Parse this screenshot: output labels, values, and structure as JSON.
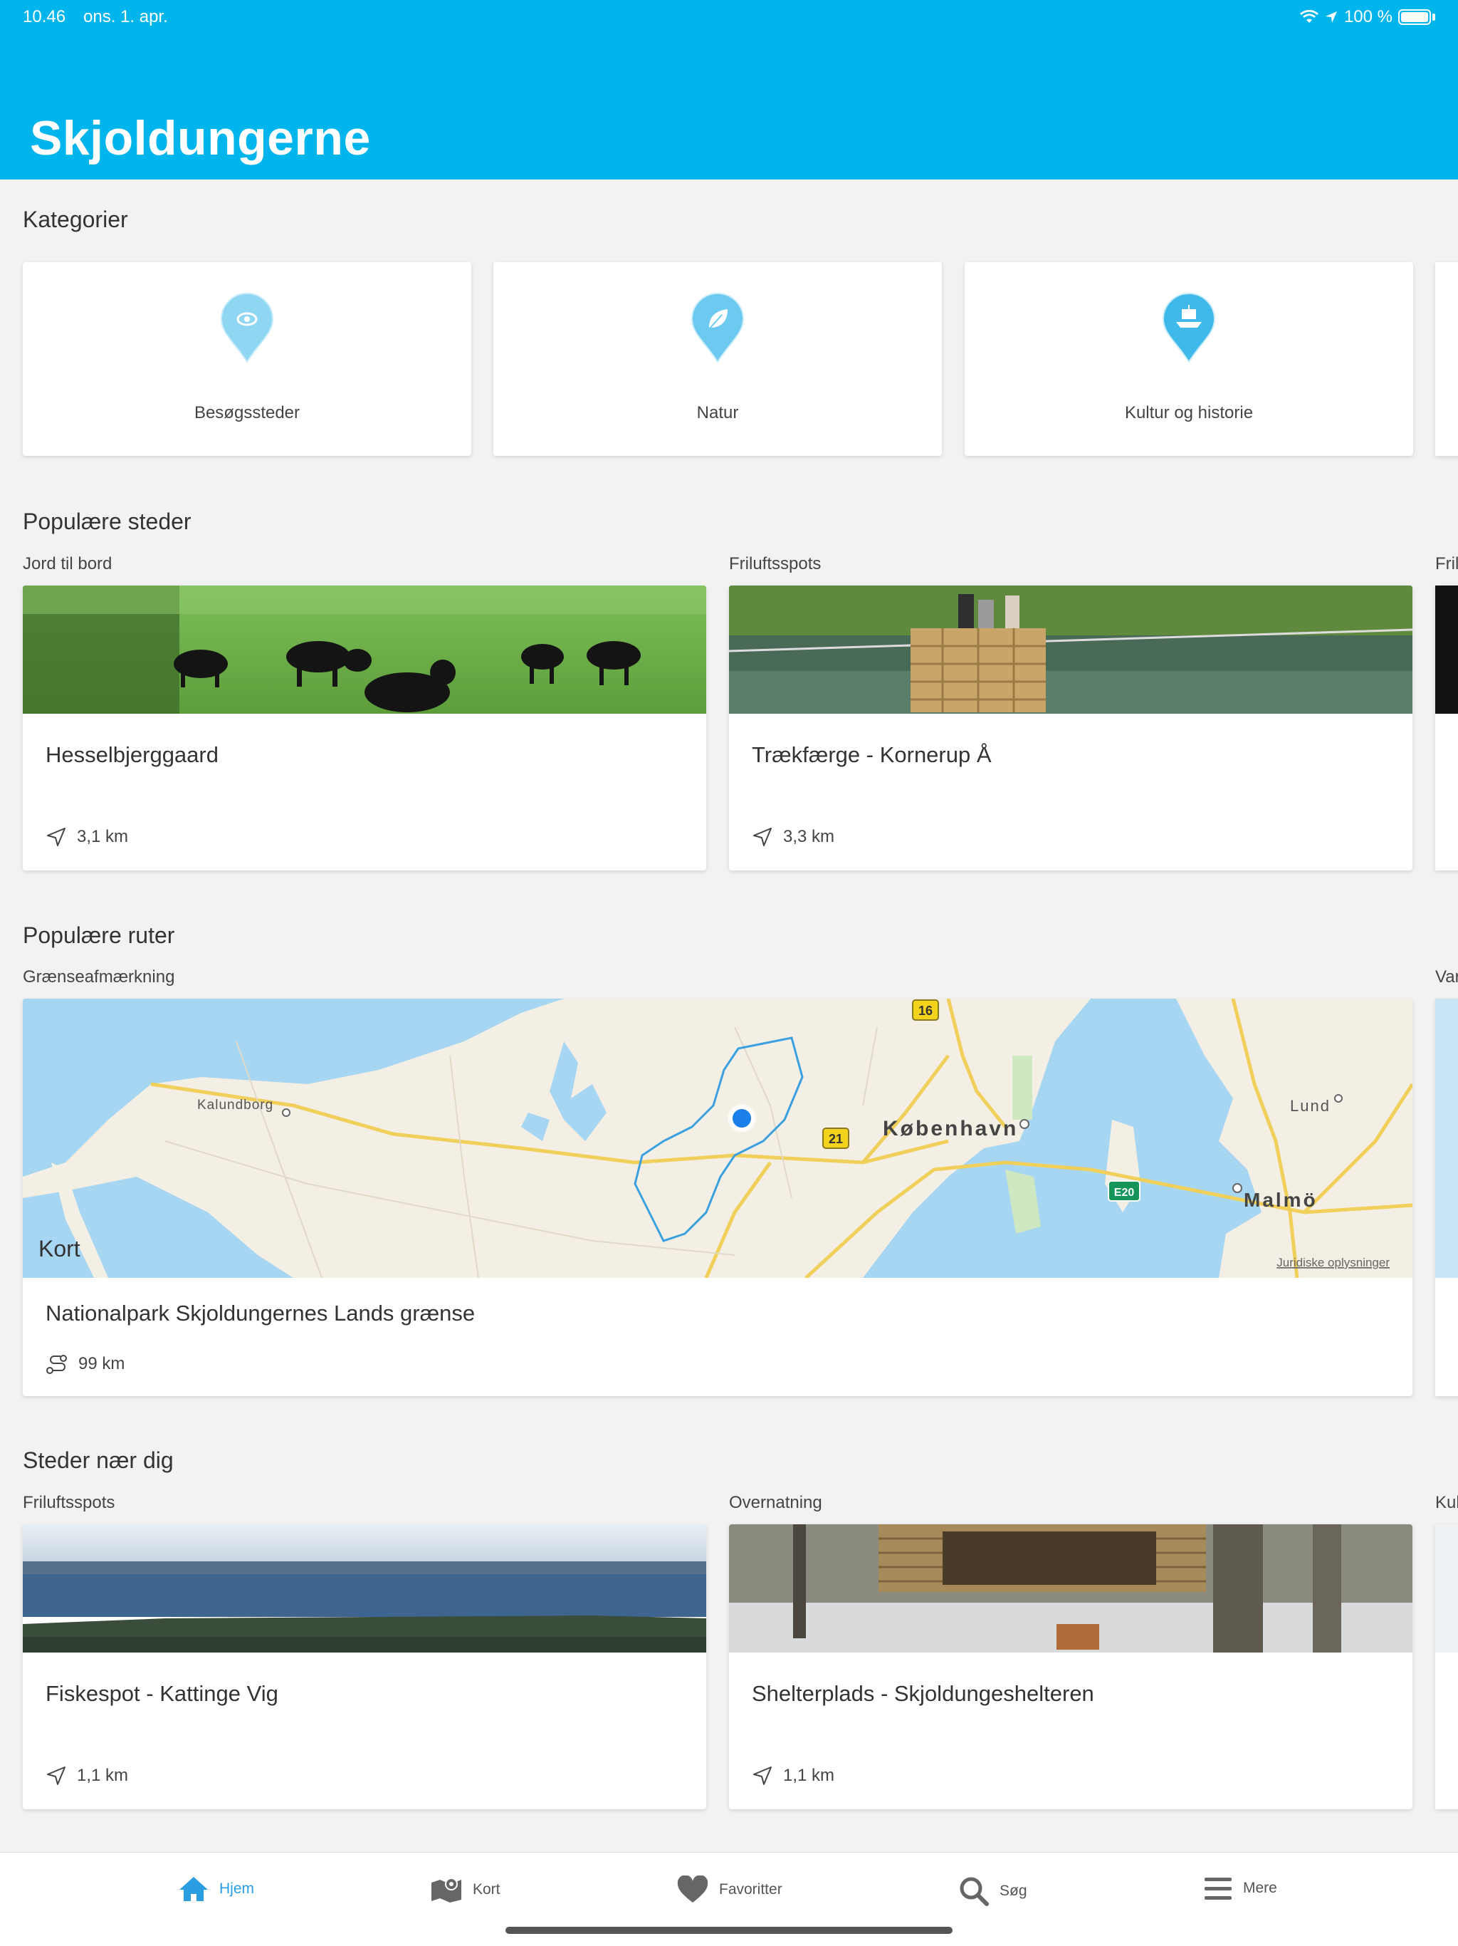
{
  "status_bar": {
    "time": "10.46",
    "date": "ons. 1. apr.",
    "battery": "100 %"
  },
  "header": {
    "title": "Skjoldungerne"
  },
  "categories": {
    "title": "Kategorier",
    "items": [
      {
        "label": "Besøgssteder",
        "icon": "eye-pin-icon"
      },
      {
        "label": "Natur",
        "icon": "leaf-pin-icon"
      },
      {
        "label": "Kultur og historie",
        "icon": "ship-pin-icon"
      }
    ]
  },
  "popular_places": {
    "title": "Populære steder",
    "items": [
      {
        "category": "Jord til bord",
        "title": "Hesselbjerggaard",
        "distance": "3,1 km"
      },
      {
        "category": "Friluftsspots",
        "title": "Trækfærge - Kornerup Å",
        "distance": "3,3 km"
      }
    ],
    "next_category_partial": "Fril"
  },
  "popular_routes": {
    "title": "Populære ruter",
    "items": [
      {
        "category": "Grænseafmærkning",
        "title": "Nationalpark Skjoldungernes Lands grænse",
        "distance": "99 km"
      }
    ],
    "next_category_partial": "Var",
    "map": {
      "labels": {
        "kalundborg": "Kalundborg",
        "kobenhavn": "København",
        "lund": "Lund",
        "malmo": "Malmö"
      },
      "road_shields": {
        "r16": "16",
        "r21": "21",
        "e20": "E20"
      },
      "attribution": "Kort",
      "legal": "Juridiske oplysninger"
    }
  },
  "nearby_places": {
    "title": "Steder nær dig",
    "items": [
      {
        "category": "Friluftsspots",
        "title": "Fiskespot - Kattinge Vig",
        "distance": "1,1 km"
      },
      {
        "category": "Overnatning",
        "title": "Shelterplads - Skjoldungeshelteren",
        "distance": "1,1 km"
      }
    ],
    "next_category_partial": "Kul"
  },
  "tabs": [
    {
      "label": "Hjem",
      "icon": "home-icon",
      "active": true
    },
    {
      "label": "Kort",
      "icon": "map-icon",
      "active": false
    },
    {
      "label": "Favoritter",
      "icon": "heart-icon",
      "active": false
    },
    {
      "label": "Søg",
      "icon": "search-icon",
      "active": false
    },
    {
      "label": "Mere",
      "icon": "menu-icon",
      "active": false
    }
  ],
  "colors": {
    "brand": "#00b4ec",
    "active_tab": "#2a9ee0",
    "pin_light": "#8fd6f2",
    "pin_dark": "#3fb8ea"
  }
}
